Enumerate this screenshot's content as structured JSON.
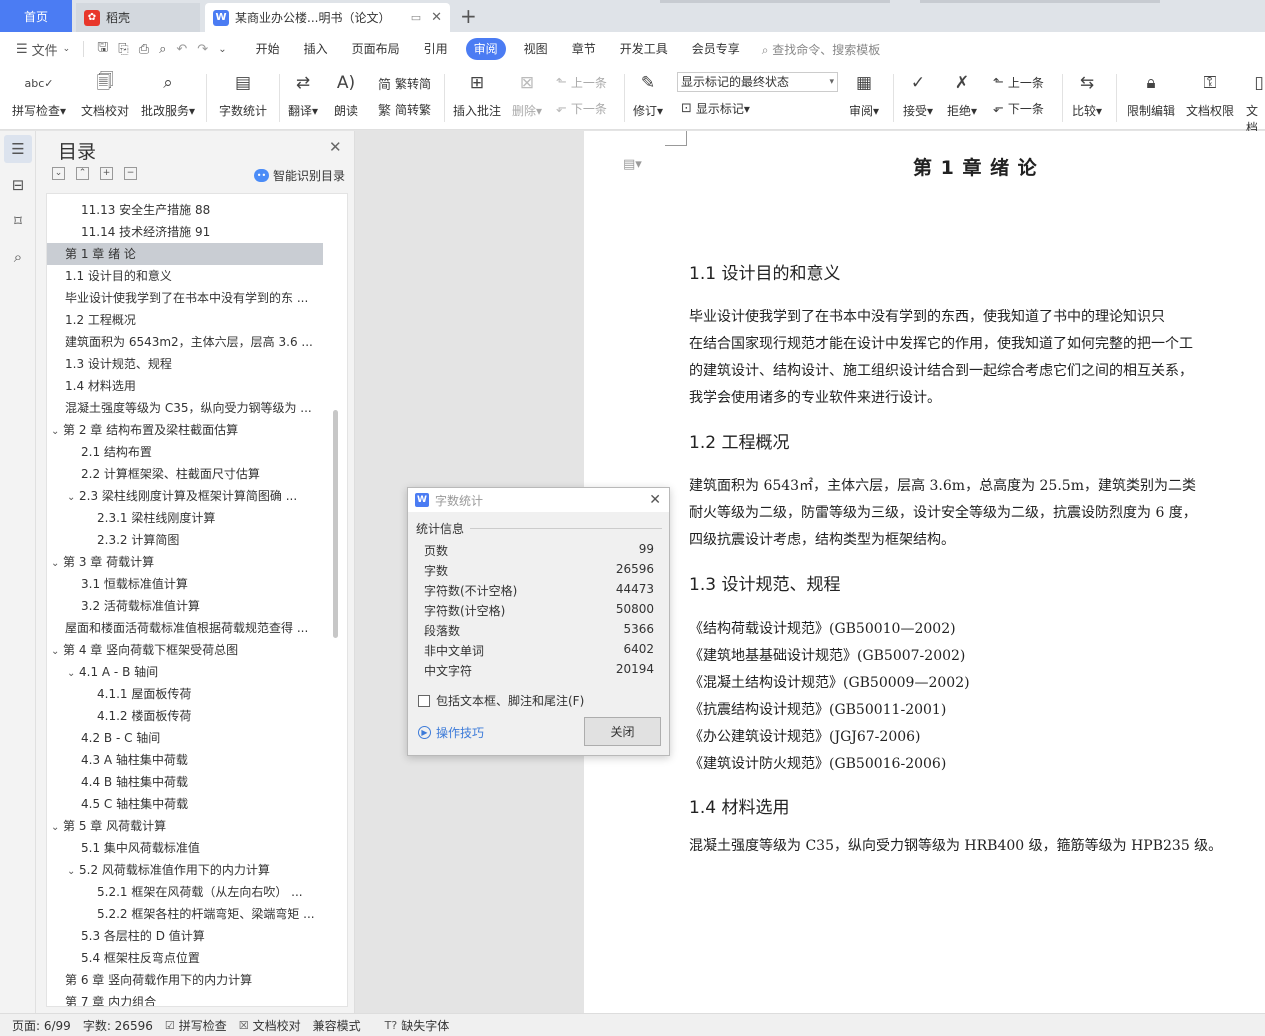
{
  "tabs": {
    "home": "首页",
    "docer": "稻壳",
    "doc": "某商业办公楼...明书（论文）"
  },
  "menu": {
    "file": "文件",
    "items": [
      "开始",
      "插入",
      "页面布局",
      "引用",
      "审阅",
      "视图",
      "章节",
      "开发工具",
      "会员专享"
    ],
    "active": "审阅",
    "search": "查找命令、搜索模板"
  },
  "ribbon": {
    "spellcheck": "拼写检查",
    "doc_proofread": "文档校对",
    "batch_service": "批改服务",
    "word_count": "字数统计",
    "translate": "翻译",
    "read_aloud": "朗读",
    "trad_to_simp": "繁转简",
    "simp_to_trad": "简转繁",
    "insert_comment": "插入批注",
    "delete": "删除",
    "prev": "上一条",
    "next": "下一条",
    "revise": "修订",
    "show_markup_final": "显示标记的最终状态",
    "show_markup": "显示标记",
    "review": "审阅",
    "accept": "接受",
    "reject": "拒绝",
    "prev2": "上一条",
    "next2": "下一条",
    "compare": "比较",
    "restrict_edit": "限制编辑",
    "doc_permission": "文档权限",
    "doc_more": "文档"
  },
  "toc": {
    "title": "目录",
    "smart": "智能识别目录",
    "items": [
      {
        "text": "11.13   安全生产措施 88",
        "level": 2,
        "caret": ""
      },
      {
        "text": "11.14   技术经济措施 91",
        "level": 2,
        "caret": ""
      },
      {
        "text": "第 1 章   绪  论",
        "level": 1,
        "caret": "",
        "selected": true
      },
      {
        "text": "1.1   设计目的和意义",
        "level": 1,
        "caret": ""
      },
      {
        "text": "毕业设计使我学到了在书本中没有学到的东 ...",
        "level": 1,
        "caret": ""
      },
      {
        "text": "1.2   工程概况",
        "level": 1,
        "caret": ""
      },
      {
        "text": "建筑面积为 6543m2，主体六层，层高 3.6 ...",
        "level": 1,
        "caret": ""
      },
      {
        "text": "1.3   设计规范、规程",
        "level": 1,
        "caret": ""
      },
      {
        "text": "1.4   材料选用",
        "level": 1,
        "caret": ""
      },
      {
        "text": "混凝土强度等级为 C35，纵向受力钢等级为 ...",
        "level": 1,
        "caret": ""
      },
      {
        "text": "第 2 章   结构布置及梁柱截面估算",
        "level": 1,
        "caret": "open"
      },
      {
        "text": "2.1   结构布置",
        "level": 2,
        "caret": ""
      },
      {
        "text": "2.2   计算框架梁、柱截面尺寸估算",
        "level": 2,
        "caret": ""
      },
      {
        "text": "2.3   梁柱线刚度计算及框架计算简图确 ...",
        "level": 2,
        "caret": "open"
      },
      {
        "text": "2.3.1     梁柱线刚度计算",
        "level": 3,
        "caret": ""
      },
      {
        "text": "2.3.2   计算简图",
        "level": 3,
        "caret": ""
      },
      {
        "text": "第 3 章   荷载计算",
        "level": 1,
        "caret": "open"
      },
      {
        "text": "3.1   恒载标准值计算",
        "level": 2,
        "caret": ""
      },
      {
        "text": "3.2   活荷载标准值计算",
        "level": 2,
        "caret": ""
      },
      {
        "text": "屋面和楼面活荷载标准值根据荷载规范查得 ...",
        "level": 1,
        "caret": ""
      },
      {
        "text": "第 4 章      竖向荷载下框架受荷总图",
        "level": 1,
        "caret": "open"
      },
      {
        "text": "4.1    A - B 轴间",
        "level": 2,
        "caret": "open"
      },
      {
        "text": "4.1.1 屋面板传荷",
        "level": 3,
        "caret": ""
      },
      {
        "text": "4.1.2 楼面板传荷",
        "level": 3,
        "caret": ""
      },
      {
        "text": "4.2    B - C 轴间",
        "level": 2,
        "caret": ""
      },
      {
        "text": "4.3    A 轴柱集中荷载",
        "level": 2,
        "caret": ""
      },
      {
        "text": "4.4    B 轴柱集中荷载",
        "level": 2,
        "caret": ""
      },
      {
        "text": "4.5    C 轴柱集中荷载",
        "level": 2,
        "caret": ""
      },
      {
        "text": "第 5 章   风荷载计算",
        "level": 1,
        "caret": "open"
      },
      {
        "text": "5.1    集中风荷载标准值",
        "level": 2,
        "caret": ""
      },
      {
        "text": "5.2    风荷载标准值作用下的内力计算",
        "level": 2,
        "caret": "open"
      },
      {
        "text": "5.2.1     框架在风荷载（从左向右吹） ...",
        "level": 3,
        "caret": ""
      },
      {
        "text": "5.2.2 框架各柱的杆端弯矩、梁端弯矩 ...",
        "level": 3,
        "caret": ""
      },
      {
        "text": "5.3    各层柱的 D 值计算",
        "level": 2,
        "caret": ""
      },
      {
        "text": "5.4    框架柱反弯点位置",
        "level": 2,
        "caret": ""
      },
      {
        "text": "第 6 章   竖向荷载作用下的内力计算",
        "level": 1,
        "caret": ""
      },
      {
        "text": "第 7 章   内力组合",
        "level": 1,
        "caret": ""
      }
    ]
  },
  "document": {
    "chapter_title": "第 1 章   绪  论",
    "sections": [
      {
        "heading": "1.1   设计目的和意义",
        "lines": [
          "      毕业设计使我学到了在书本中没有学到的东西，使我知道了书中的理论知识只",
          "在结合国家现行规范才能在设计中发挥它的作用，使我知道了如何完整的把一个工",
          "的建筑设计、结构设计、施工组织设计结合到一起综合考虑它们之间的相互关系，",
          "我学会使用诸多的专业软件来进行设计。"
        ]
      },
      {
        "heading": "1.2   工程概况",
        "lines": [
          "      建筑面积为 6543㎡，主体六层，层高 3.6m，总高度为 25.5m，建筑类别为二类",
          "耐火等级为二级，防雷等级为三级，设计安全等级为二级，抗震设防烈度为 6 度，",
          "四级抗震设计考虑，结构类型为框架结构。"
        ]
      },
      {
        "heading": "1.3   设计规范、规程",
        "lines": [
          "《结构荷载设计规范》(GB50010—2002)",
          "《建筑地基基础设计规范》(GB5007-2002)",
          "《混凝土结构设计规范》(GB50009—2002)",
          "《抗震结构设计规范》(GB50011-2001)",
          "《办公建筑设计规范》(JGJ67-2006)",
          "《建筑设计防火规范》(GB50016-2006)"
        ]
      },
      {
        "heading": "1.4   材料选用",
        "lines": [
          "混凝土强度等级为 C35，纵向受力钢等级为 HRB400 级，箍筋等级为 HPB235 级。"
        ]
      }
    ]
  },
  "dialog": {
    "title": "字数统计",
    "group": "统计信息",
    "stats": [
      {
        "label": "页数",
        "value": "99"
      },
      {
        "label": "字数",
        "value": "26596"
      },
      {
        "label": "字符数(不计空格)",
        "value": "44473"
      },
      {
        "label": "字符数(计空格)",
        "value": "50800"
      },
      {
        "label": "段落数",
        "value": "5366"
      },
      {
        "label": "非中文单词",
        "value": "6402"
      },
      {
        "label": "中文字符",
        "value": "20194"
      }
    ],
    "checkbox": "包括文本框、脚注和尾注(F)",
    "tips": "操作技巧",
    "close": "关闭"
  },
  "statusbar": {
    "page": "页面: 6/99",
    "words": "字数: 26596",
    "spellcheck": "拼写检查",
    "proofread": "文档校对",
    "compat": "兼容模式",
    "missing_font": "缺失字体"
  },
  "colors": {
    "accent": "#4b7cf3",
    "docer": "#e8372b"
  }
}
